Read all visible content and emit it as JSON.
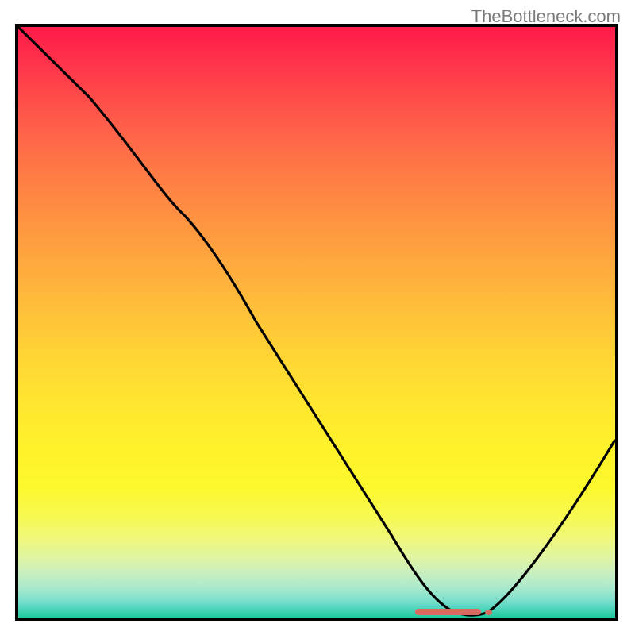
{
  "watermark": "TheBottleneck.com",
  "chart_data": {
    "type": "line",
    "title": "",
    "xlabel": "",
    "ylabel": "",
    "xlim": [
      0,
      100
    ],
    "ylim": [
      0,
      100
    ],
    "series": [
      {
        "name": "curve",
        "x": [
          0,
          12,
          25,
          28,
          40,
          50,
          60,
          65,
          70,
          74,
          78,
          90,
          100
        ],
        "values": [
          100,
          88,
          71,
          68,
          50,
          36,
          22,
          13,
          5,
          1,
          1,
          16,
          30
        ]
      }
    ],
    "marker": {
      "x_start": 67,
      "x_end": 78,
      "y": 0.7
    },
    "gradient_stops": [
      {
        "pos": 0,
        "color": "#ff1a49"
      },
      {
        "pos": 50,
        "color": "#ffc039"
      },
      {
        "pos": 80,
        "color": "#fdf82d"
      },
      {
        "pos": 100,
        "color": "#1ec99e"
      }
    ]
  }
}
